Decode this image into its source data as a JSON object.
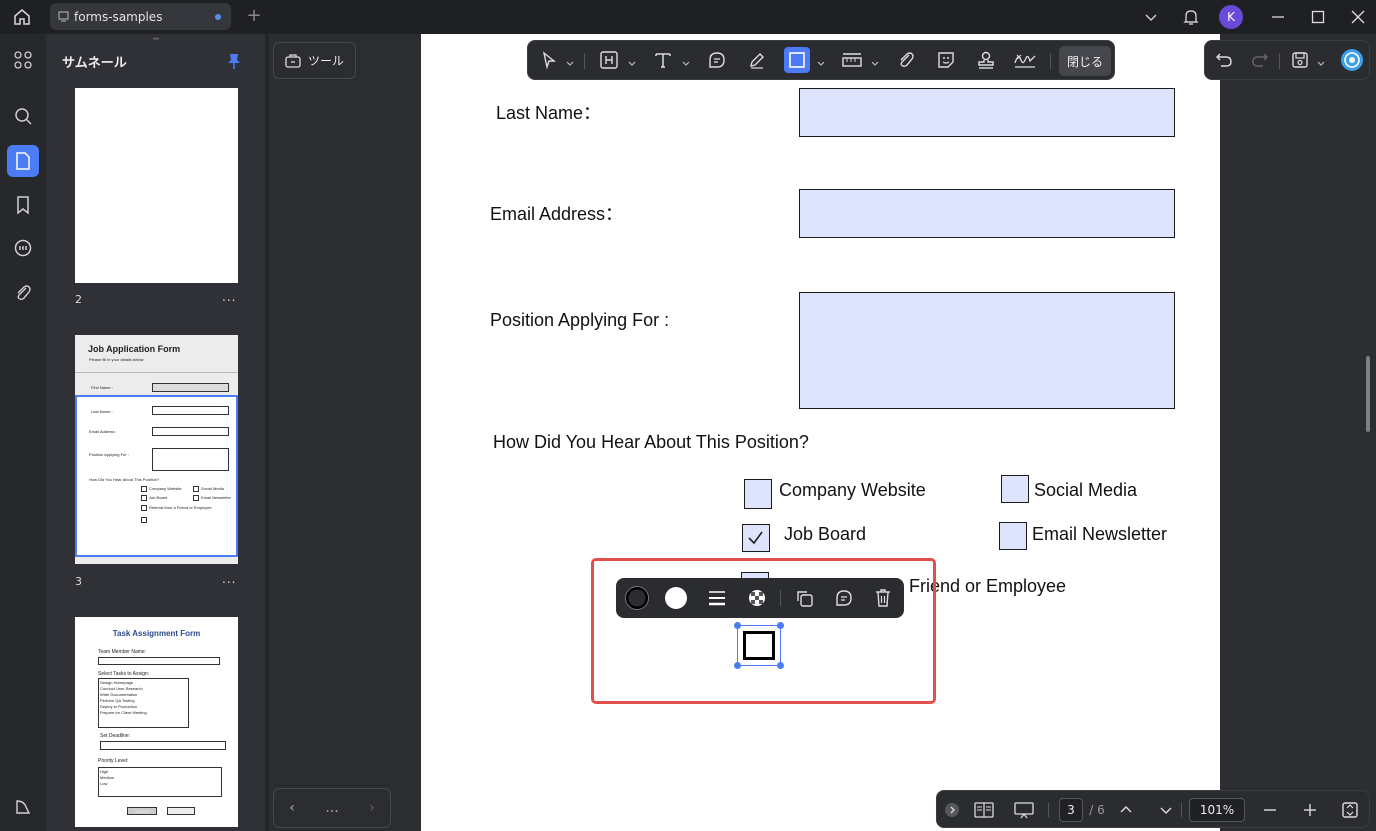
{
  "titlebar": {
    "tab_title": "forms-samples",
    "avatar_initial": "K"
  },
  "thumbs": {
    "title": "サムネール",
    "pages": [
      {
        "num": "2",
        "more": "..."
      },
      {
        "num": "3",
        "more": "..."
      }
    ],
    "page3_thumb": {
      "title": "Job Application Form",
      "subtitle": "Please fill in your details below",
      "labels": [
        "First Name :",
        "Last Name :",
        "Email Address :",
        "Position Applying For :",
        "How Did You Hear About This Position?"
      ],
      "options": [
        "Company Website",
        "Social Media",
        "Job Board",
        "Email Newsletter",
        "Referral from a Friend or Employee"
      ]
    },
    "page4_thumb": {
      "title": "Task Assignment Form",
      "member_label": "Team Member Name:",
      "tasks_label": "Select Tasks to Assign:",
      "tasks": [
        "Design Homepage",
        "Conduct User Research",
        "Write Documentation",
        "Perform QA Testing",
        "Deploy to Production",
        "Prepare for Client Meeting"
      ],
      "deadline_label": "Set Deadline:",
      "priority_label": "Priority Level:",
      "priorities": [
        "High",
        "Medium",
        "Low"
      ],
      "submit": "Submit",
      "clear": "Clear Form"
    }
  },
  "midpanel": {
    "tools_label": "ツール",
    "nav_more": "..."
  },
  "toolbar": {
    "close_label": "閉じる"
  },
  "form": {
    "last_name": "Last Name：",
    "email": "Email Address：",
    "position": "Position Applying For :",
    "how_heard": "How Did You Hear About This Position?",
    "opt_company_website": "Company Website",
    "opt_social_media": "Social Media",
    "opt_job_board": "Job Board",
    "opt_email_newsletter": "Email Newsletter",
    "opt_referral_partial": "Friend or Employee"
  },
  "bottombar": {
    "current_page": "3",
    "total_pages": "/ 6",
    "zoom": "101%"
  },
  "colors": {
    "accent": "#4b7cf5",
    "selection": "#e2504c",
    "field_fill": "#dfe4fd"
  }
}
